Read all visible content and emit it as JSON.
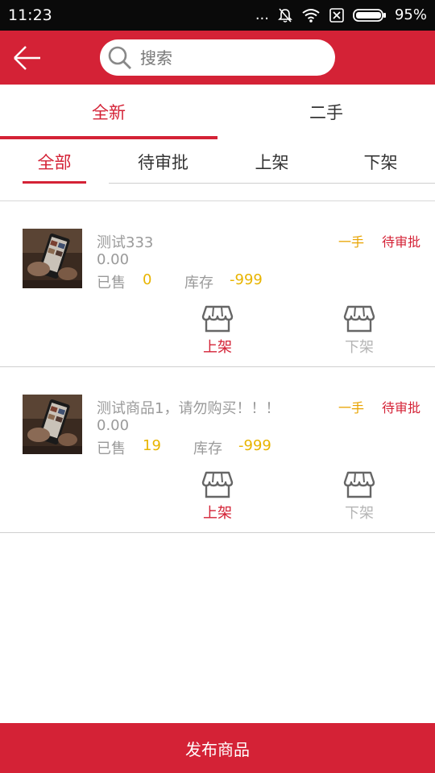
{
  "status_bar": {
    "time": "11:23",
    "dots": "...",
    "battery": "95%"
  },
  "header": {
    "search_placeholder": "搜索"
  },
  "main_tabs": [
    {
      "label": "全新",
      "active": true
    },
    {
      "label": "二手",
      "active": false
    }
  ],
  "sub_tabs": [
    {
      "label": "全部",
      "active": true
    },
    {
      "label": "待审批",
      "active": false
    },
    {
      "label": "上架",
      "active": false
    },
    {
      "label": "下架",
      "active": false
    }
  ],
  "products": [
    {
      "name": "测试333",
      "price": "0.00",
      "sold_label": "已售",
      "sold": "0",
      "stock_label": "库存",
      "stock": "-999",
      "condition": "一手",
      "status": "待审批",
      "action_on": "上架",
      "action_off": "下架"
    },
    {
      "name": "测试商品1，请勿购买！！！",
      "price": "0.00",
      "sold_label": "已售",
      "sold": "19",
      "stock_label": "库存",
      "stock": "-999",
      "condition": "一手",
      "status": "待审批",
      "action_on": "上架",
      "action_off": "下架"
    }
  ],
  "publish_button": "发布商品",
  "colors": {
    "accent": "#d42236",
    "highlight": "#e8b400",
    "muted": "#9a9a9a"
  }
}
